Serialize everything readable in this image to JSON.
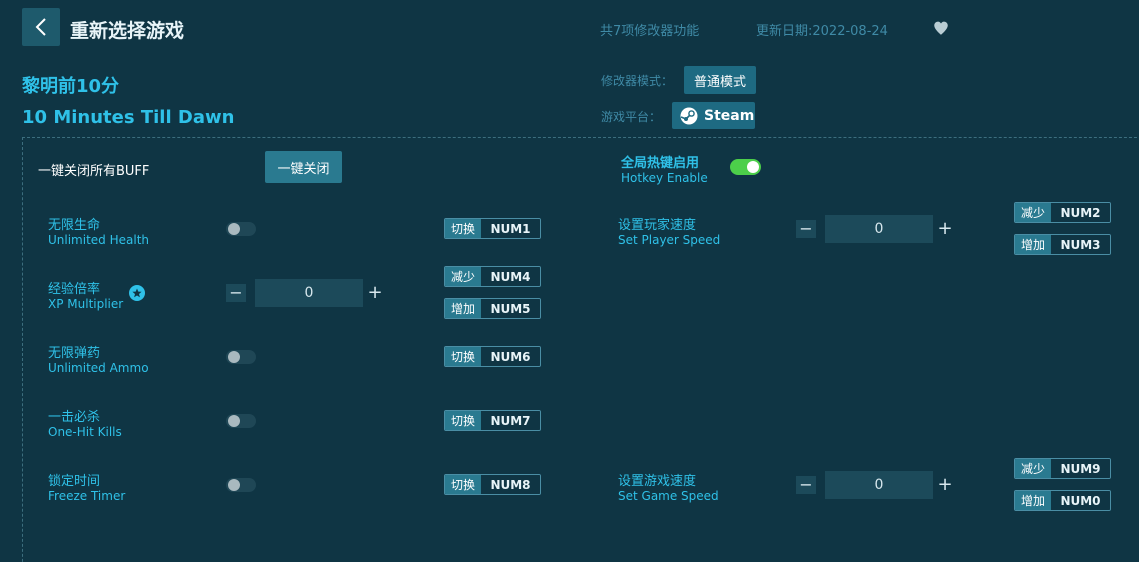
{
  "header": {
    "title": "重新选择游戏",
    "feature_count": "共7项修改器功能",
    "update_date": "更新日期:2022-08-24"
  },
  "game": {
    "name_cn": "黎明前10分",
    "name_en": "10 Minutes Till Dawn",
    "mode_label": "修改器模式：",
    "mode_value": "普通模式",
    "platform_label": "游戏平台：",
    "platform_value": "Steam"
  },
  "panel": {
    "close_all_label": "一键关闭所有BUFF",
    "close_all_button": "一键关闭",
    "hotkey_cn": "全局热键启用",
    "hotkey_en": "Hotkey Enable",
    "hotkey_enabled": true
  },
  "options_left": [
    {
      "cn": "无限生命",
      "en": "Unlimited Health",
      "type": "toggle",
      "on": false,
      "keys": [
        {
          "label": "切换",
          "value": "NUM1"
        }
      ]
    },
    {
      "cn": "经验倍率",
      "en": "XP Multiplier",
      "type": "stepper",
      "value": "0",
      "starred": true,
      "keys": [
        {
          "label": "减少",
          "value": "NUM4"
        },
        {
          "label": "增加",
          "value": "NUM5"
        }
      ]
    },
    {
      "cn": "无限弹药",
      "en": "Unlimited Ammo",
      "type": "toggle",
      "on": false,
      "keys": [
        {
          "label": "切换",
          "value": "NUM6"
        }
      ]
    },
    {
      "cn": "一击必杀",
      "en": "One-Hit Kills",
      "type": "toggle",
      "on": false,
      "keys": [
        {
          "label": "切换",
          "value": "NUM7"
        }
      ]
    },
    {
      "cn": "锁定时间",
      "en": "Freeze Timer",
      "type": "toggle",
      "on": false,
      "keys": [
        {
          "label": "切换",
          "value": "NUM8"
        }
      ]
    }
  ],
  "options_right": [
    {
      "cn": "设置玩家速度",
      "en": "Set Player Speed",
      "type": "stepper",
      "value": "0",
      "keys": [
        {
          "label": "减少",
          "value": "NUM2"
        },
        {
          "label": "增加",
          "value": "NUM3"
        }
      ]
    },
    {
      "cn": "设置游戏速度",
      "en": "Set Game Speed",
      "type": "stepper",
      "value": "0",
      "keys": [
        {
          "label": "减少",
          "value": "NUM9"
        },
        {
          "label": "增加",
          "value": "NUM0"
        }
      ]
    }
  ],
  "stepper": {
    "minus": "−",
    "plus": "+"
  },
  "colors": {
    "background": "#0f3544",
    "accent": "#2fc1e8",
    "button": "#2a7a90",
    "toggle_on": "#4ccf4a"
  },
  "icons": {
    "back": "chevron-left-icon",
    "favorite": "heart-icon",
    "platform": "steam-icon",
    "featured": "star-icon"
  }
}
